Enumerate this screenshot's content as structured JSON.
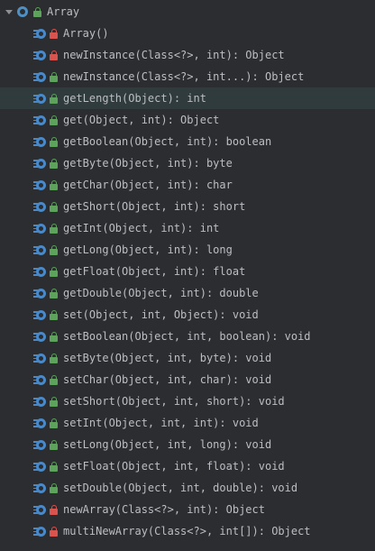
{
  "tree": {
    "root": {
      "label": "Array",
      "expanded": true,
      "icon": "class-icon",
      "visibility": "public"
    },
    "members": [
      {
        "label": "Array()",
        "visibility": "private",
        "selected": false
      },
      {
        "label": "newInstance(Class<?>, int): Object",
        "visibility": "private",
        "selected": false
      },
      {
        "label": "newInstance(Class<?>, int...): Object",
        "visibility": "public",
        "selected": false
      },
      {
        "label": "getLength(Object): int",
        "visibility": "public",
        "selected": true
      },
      {
        "label": "get(Object, int): Object",
        "visibility": "public",
        "selected": false
      },
      {
        "label": "getBoolean(Object, int): boolean",
        "visibility": "public",
        "selected": false
      },
      {
        "label": "getByte(Object, int): byte",
        "visibility": "public",
        "selected": false
      },
      {
        "label": "getChar(Object, int): char",
        "visibility": "public",
        "selected": false
      },
      {
        "label": "getShort(Object, int): short",
        "visibility": "public",
        "selected": false
      },
      {
        "label": "getInt(Object, int): int",
        "visibility": "public",
        "selected": false
      },
      {
        "label": "getLong(Object, int): long",
        "visibility": "public",
        "selected": false
      },
      {
        "label": "getFloat(Object, int): float",
        "visibility": "public",
        "selected": false
      },
      {
        "label": "getDouble(Object, int): double",
        "visibility": "public",
        "selected": false
      },
      {
        "label": "set(Object, int, Object): void",
        "visibility": "public",
        "selected": false
      },
      {
        "label": "setBoolean(Object, int, boolean): void",
        "visibility": "public",
        "selected": false
      },
      {
        "label": "setByte(Object, int, byte): void",
        "visibility": "public",
        "selected": false
      },
      {
        "label": "setChar(Object, int, char): void",
        "visibility": "public",
        "selected": false
      },
      {
        "label": "setShort(Object, int, short): void",
        "visibility": "public",
        "selected": false
      },
      {
        "label": "setInt(Object, int, int): void",
        "visibility": "public",
        "selected": false
      },
      {
        "label": "setLong(Object, int, long): void",
        "visibility": "public",
        "selected": false
      },
      {
        "label": "setFloat(Object, int, float): void",
        "visibility": "public",
        "selected": false
      },
      {
        "label": "setDouble(Object, int, double): void",
        "visibility": "public",
        "selected": false
      },
      {
        "label": "newArray(Class<?>, int): Object",
        "visibility": "private",
        "selected": false
      },
      {
        "label": "multiNewArray(Class<?>, int[]): Object",
        "visibility": "private",
        "selected": false
      }
    ]
  },
  "colors": {
    "background": "#2b2d30",
    "selected_row": "#2f3b3d",
    "text": "#bcbec4",
    "method_icon": "#4a89c8",
    "public_lock": "#5ea35c",
    "private_lock": "#d9534f"
  }
}
